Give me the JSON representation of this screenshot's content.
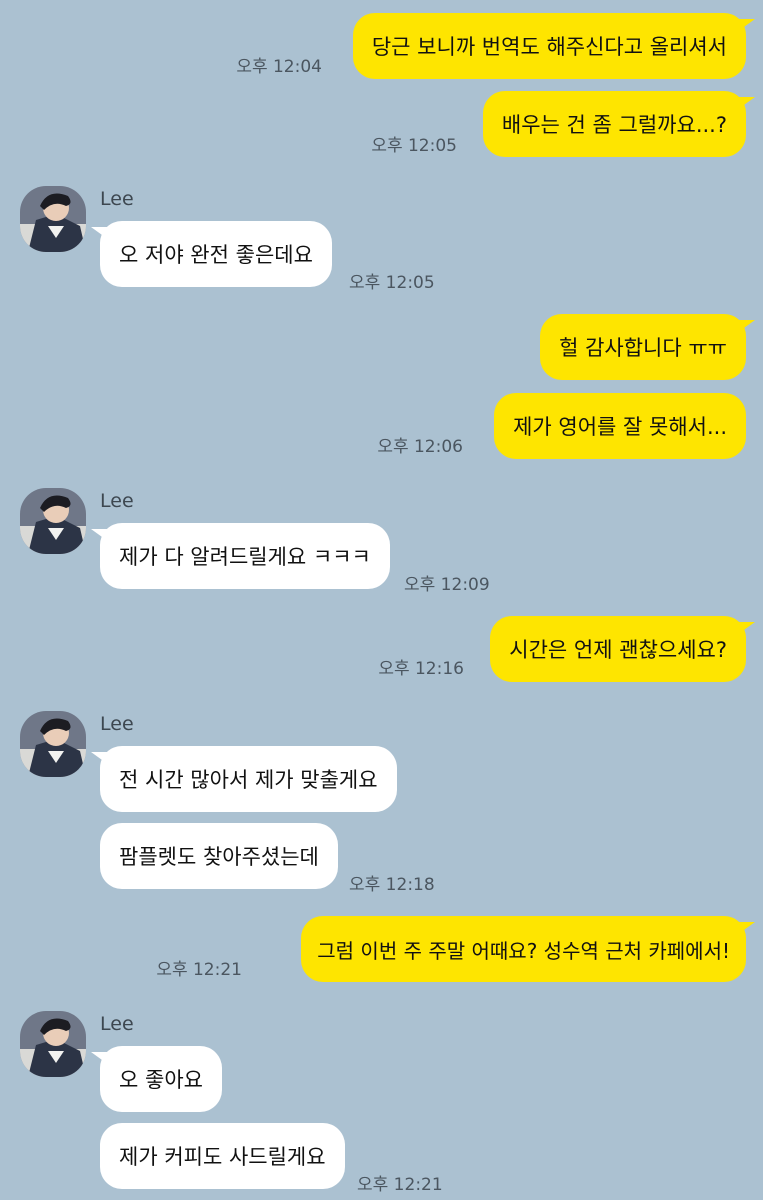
{
  "messages": {
    "m1": {
      "text": "당근 보니까 번역도 해주신다고 올리셔서",
      "time": "오후 12:04"
    },
    "m2": {
      "text": "배우는 건 좀 그럴까요...?",
      "time": "오후 12:05"
    },
    "lee1": {
      "name": "Lee",
      "text": "오 저야 완전 좋은데요",
      "time": "오후 12:05"
    },
    "m3": {
      "text": "헐 감사합니다 ㅠㅠ"
    },
    "m4": {
      "text": "제가 영어를 잘 못해서...",
      "time": "오후 12:06"
    },
    "lee2": {
      "name": "Lee",
      "text": "제가 다 알려드릴게요 ㅋㅋㅋ",
      "time": "오후 12:09"
    },
    "m5": {
      "text": "시간은 언제 괜찮으세요?",
      "time": "오후 12:16"
    },
    "lee3": {
      "name": "Lee",
      "text1": "전 시간 많아서 제가 맞출게요",
      "text2": "팜플렛도 찾아주셨는데",
      "time": "오후 12:18"
    },
    "m6": {
      "text": "그럼 이번 주 주말 어때요? 성수역 근처 카페에서!",
      "time": "오후 12:21"
    },
    "lee4": {
      "name": "Lee",
      "text1": "오 좋아요",
      "text2": "제가 커피도 사드릴게요",
      "time": "오후 12:21"
    }
  },
  "colors": {
    "background": "#abc1d1",
    "my_bubble": "#fee500",
    "other_bubble": "#ffffff"
  },
  "icons": {
    "avatar": "profile-photo-avatar"
  }
}
